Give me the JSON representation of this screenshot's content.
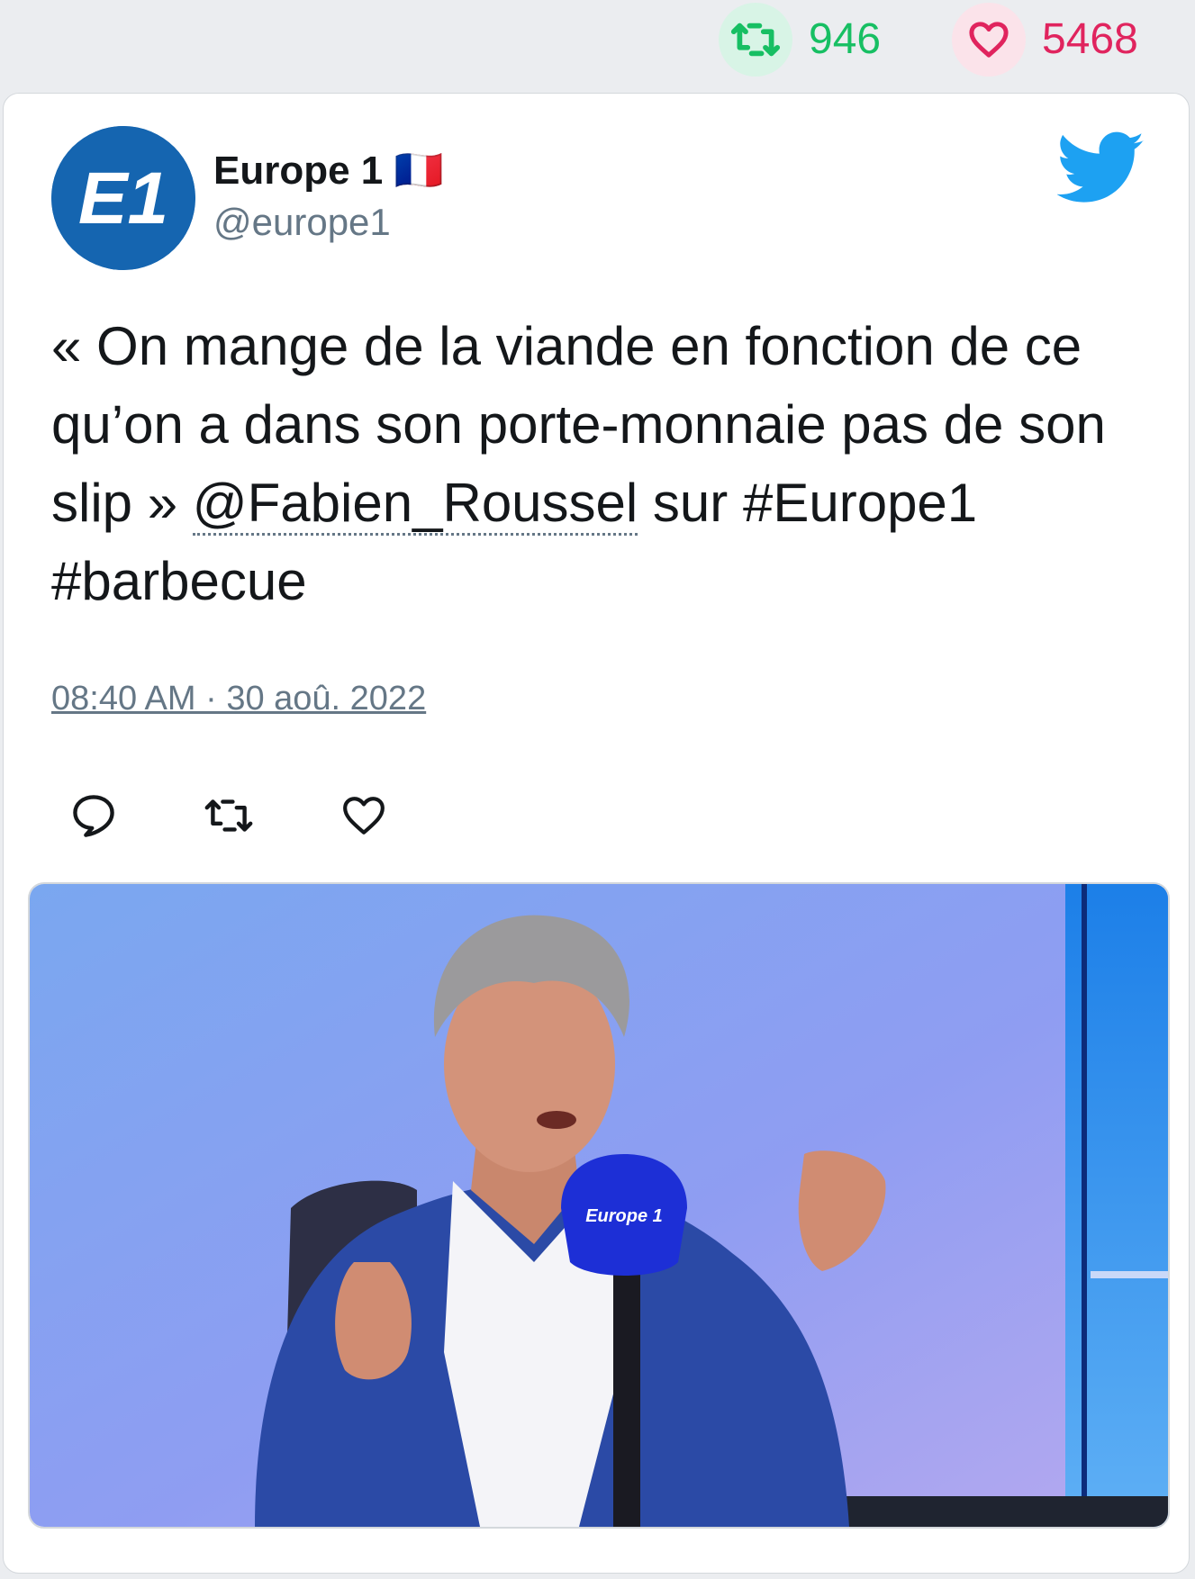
{
  "stats": {
    "retweet_count": "946",
    "like_count": "5468"
  },
  "tweet": {
    "display_name": "Europe 1 🇫🇷",
    "handle": "@europe1",
    "text_before": "« On mange de la viande en fonction de ce qu’on a dans son porte-monnaie pas de son slip » ",
    "mention": "@Fabien_Roussel",
    "text_after": " sur #Europe1 #barbecue",
    "timestamp": "08:40 AM · 30 aoû. 2022",
    "avatar_logo_text": "E1",
    "mic_label": "Europe 1"
  },
  "icons": {
    "retweet": "retweet-icon",
    "like": "heart-icon",
    "reply": "reply-icon",
    "brand": "twitter-bird-icon"
  },
  "colors": {
    "retweet_green": "#17bf63",
    "like_red": "#e0245e",
    "twitter_blue": "#1da1f2",
    "avatar_blue": "#1565b0"
  }
}
